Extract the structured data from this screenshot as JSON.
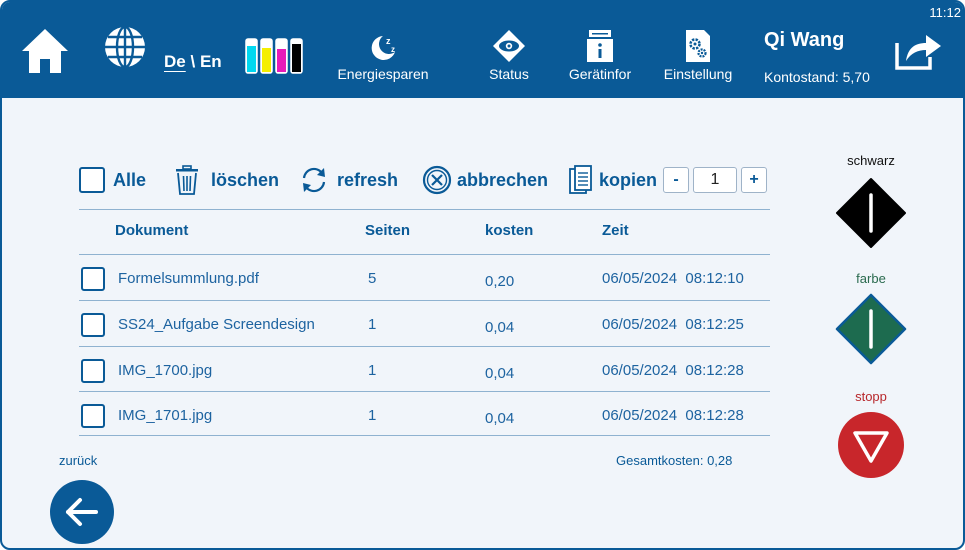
{
  "header": {
    "time": "11:12",
    "language": {
      "active": "De",
      "separator": "\\",
      "other": "En"
    },
    "nav": [
      {
        "id": "energy",
        "label": "Energiesparen",
        "icon": "moon-sleep-icon"
      },
      {
        "id": "status",
        "label": "Status",
        "icon": "eye-diamond-icon"
      },
      {
        "id": "info",
        "label": "Gerätinfor",
        "icon": "printer-info-icon"
      },
      {
        "id": "settings",
        "label": "Einstellung",
        "icon": "gear-document-icon"
      }
    ],
    "user": {
      "name": "Qi Wang",
      "balance_label": "Kontostand:",
      "balance_value": "5,70"
    }
  },
  "toolbar": {
    "select_all": "Alle",
    "delete": "löschen",
    "refresh": "refresh",
    "cancel": "abbrechen",
    "copies": "kopien",
    "copy_count": "1",
    "minus": "-",
    "plus": "+"
  },
  "table": {
    "columns": [
      "Dokument",
      "Seiten",
      "kosten",
      "Zeit"
    ],
    "rows": [
      {
        "name": "Formelsummlung.pdf",
        "pages": "5",
        "cost": "0,20",
        "date": "06/05/2024",
        "time": "08:12:10"
      },
      {
        "name": "SS24_Aufgabe Screendesign",
        "pages": "1",
        "cost": "0,04",
        "date": "06/05/2024",
        "time": "08:12:25"
      },
      {
        "name": "IMG_1700.jpg",
        "pages": "1",
        "cost": "0,04",
        "date": "06/05/2024",
        "time": "08:12:28"
      },
      {
        "name": "IMG_1701.jpg",
        "pages": "1",
        "cost": "0,04",
        "date": "06/05/2024",
        "time": "08:12:28"
      }
    ]
  },
  "footer": {
    "total_label": "Gesamtkosten:",
    "total_value": "0,28",
    "back_label": "zurück"
  },
  "side": {
    "black_label": "schwarz",
    "color_label": "farbe",
    "stop_label": "stopp"
  },
  "colors": {
    "primary": "#0a5a97",
    "background": "#f1f5fa",
    "black_button": "#000000",
    "color_button": "#1d6b4f",
    "stop_button": "#c8262b",
    "ink_cyan": "#00d8f0",
    "ink_yellow": "#f5ef00",
    "ink_magenta": "#e81ab9",
    "ink_black": "#000000"
  }
}
